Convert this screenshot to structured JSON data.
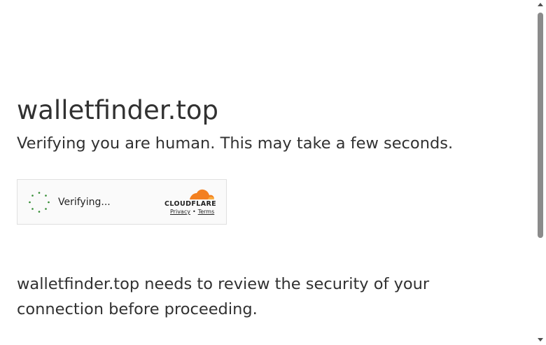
{
  "page": {
    "site_title": "walletfinder.top",
    "subtitle": "Verifying you are human. This may take a few seconds.",
    "body_text": "walletfinder.top needs to review the security of your connection before proceeding."
  },
  "widget": {
    "status_text": "Verifying...",
    "brand_wordmark": "CLOUDFLARE",
    "privacy_label": "Privacy",
    "separator": "•",
    "terms_label": "Terms",
    "spinner_icon": "loading-spinner-icon",
    "spinner_color": "#2f8a2f",
    "brand_colors": {
      "orange": "#f38020",
      "light_orange": "#faae40"
    }
  },
  "scrollbar": {
    "up_icon": "scroll-up-arrow-icon",
    "down_icon": "scroll-down-arrow-icon"
  }
}
